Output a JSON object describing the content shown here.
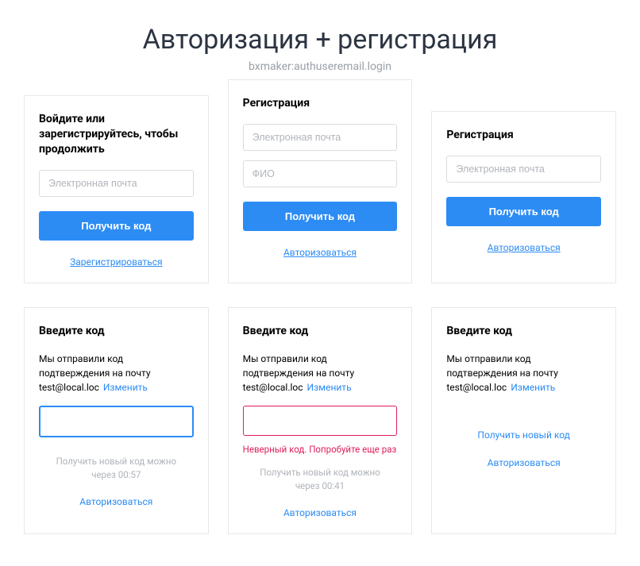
{
  "header": {
    "title": "Авторизация + регистрация",
    "subtitle": "bxmaker:authuseremail.login"
  },
  "cards": {
    "login": {
      "title": "Войдите или зарегистрируйтесь, чтобы продолжить",
      "email_placeholder": "Электронная почта",
      "button": "Получить код",
      "register_link": "Зарегистрироваться"
    },
    "reg_full": {
      "title": "Регистрация",
      "email_placeholder": "Электронная почта",
      "fio_placeholder": "ФИО",
      "button": "Получить код",
      "auth_link": "Авторизоваться"
    },
    "reg_simple": {
      "title": "Регистрация",
      "email_placeholder": "Электронная почта",
      "button": "Получить код",
      "auth_link": "Авторизоваться"
    },
    "code1": {
      "title": "Введите код",
      "desc_prefix": "Мы отправили код подтверждения на почту ",
      "email": "test@local.loc",
      "change": "Изменить",
      "timer_line1": "Получить новый код можно",
      "timer_line2": "через 00:57",
      "auth_link": "Авторизоваться"
    },
    "code2": {
      "title": "Введите код",
      "desc_prefix": "Мы отправили код подтверждения на почту ",
      "email": "test@local.loc",
      "change": "Изменить",
      "error": "Неверный код. Попробуйте еще раз",
      "timer_line1": "Получить новый код можно",
      "timer_line2": "через 00:41",
      "auth_link": "Авторизоваться"
    },
    "code3": {
      "title": "Введите код",
      "desc_prefix": "Мы отправили код подтверждения на почту ",
      "email": "test@local.loc",
      "change": "Изменить",
      "newcode_link": "Получить новый код",
      "auth_link": "Авторизоваться"
    }
  }
}
